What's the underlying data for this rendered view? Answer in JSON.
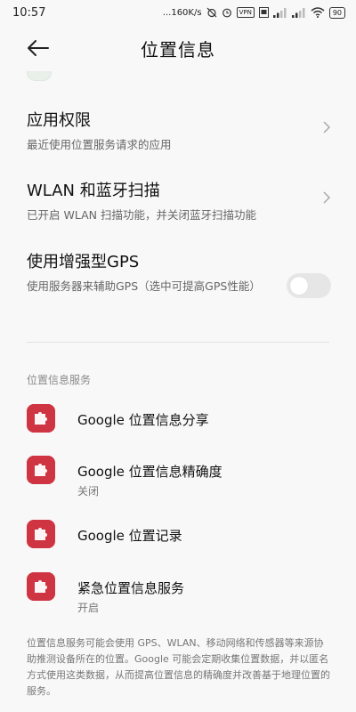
{
  "status_bar": {
    "time": "10:57",
    "net_speed": "...160K/s",
    "vpn": "VPN",
    "battery": "90"
  },
  "header": {
    "title": "位置信息",
    "back_icon": "arrow-left-icon"
  },
  "settings": [
    {
      "title": "应用权限",
      "subtitle": "最近使用位置服务请求的应用",
      "control": "chevron"
    },
    {
      "title": "WLAN 和蓝牙扫描",
      "subtitle": "已开启 WLAN 扫描功能，并关闭蓝牙扫描功能",
      "control": "chevron"
    },
    {
      "title": "使用增强型GPS",
      "subtitle": "使用服务器来辅助GPS（选中可提高GPS性能）",
      "control": "toggle",
      "toggle_on": false
    }
  ],
  "section_label": "位置信息服务",
  "services": [
    {
      "name": "Google 位置信息分享",
      "subtitle": ""
    },
    {
      "name": "Google 位置信息精确度",
      "subtitle": "关闭"
    },
    {
      "name": "Google 位置记录",
      "subtitle": ""
    },
    {
      "name": "紧急位置信息服务",
      "subtitle": "开启"
    }
  ],
  "footer": "位置信息服务可能会使用 GPS、WLAN、移动网络和传感器等来源协助推测设备所在的位置。Google 可能会定期收集位置数据，并以匿名方式使用这类数据，从而提高位置信息的精确度并改善基于地理位置的服务。",
  "colors": {
    "background": "#f8f8f8",
    "service_icon": "#cf3442",
    "toggle_off": "#e6e6e6",
    "secondary_text": "#666666"
  }
}
